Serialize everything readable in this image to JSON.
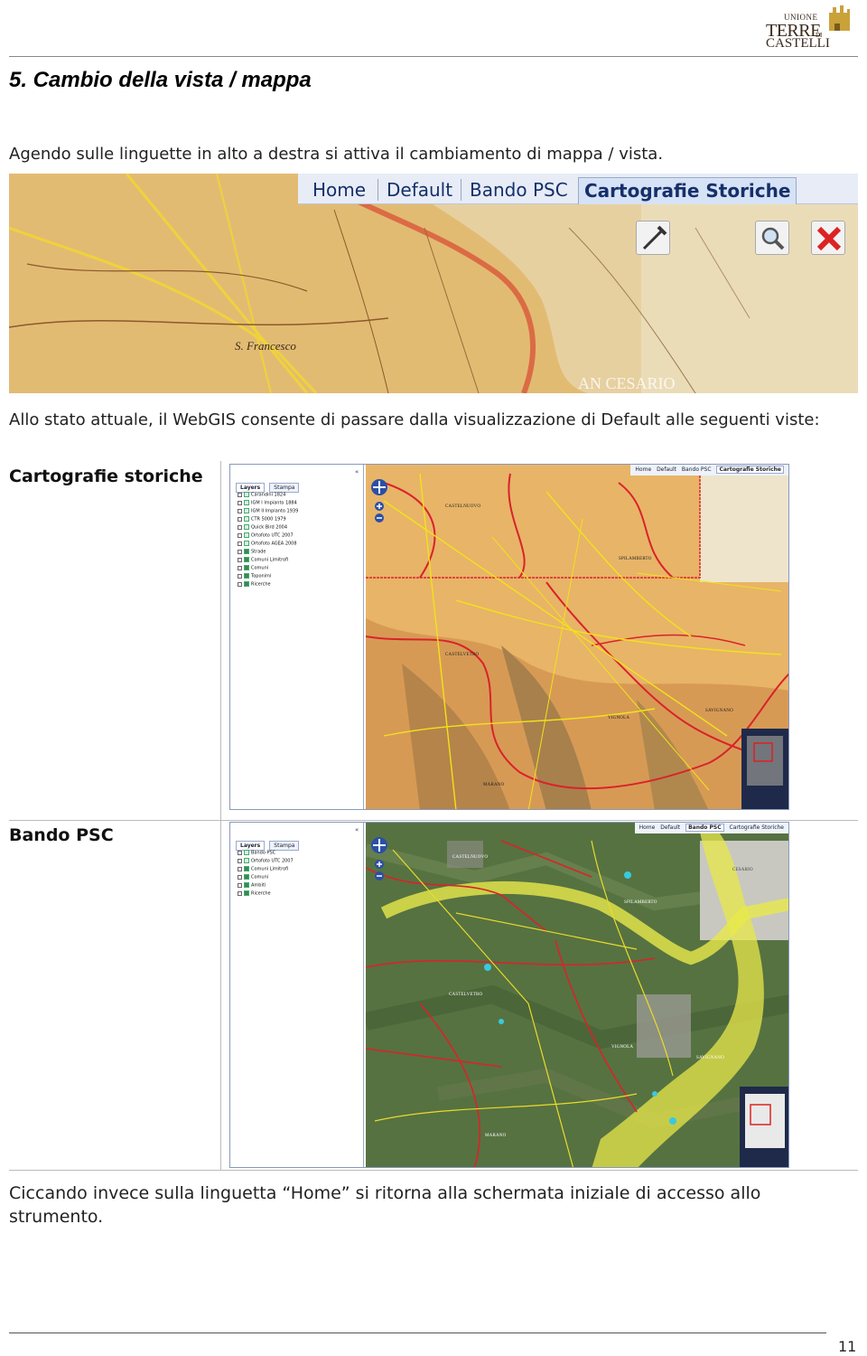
{
  "header": {
    "logo": {
      "small": "UNIONE",
      "mid": "TERRE",
      "di": "DI",
      "big": "CASTELLI"
    }
  },
  "title": "5. Cambio della vista / mappa",
  "para1": "Agendo sulle linguette in alto a destra si attiva il cambiamento di mappa / vista.",
  "shot1": {
    "tabs": [
      "Home",
      "Default",
      "Bando PSC",
      "Cartografie Storiche"
    ],
    "active_tab": "Cartografie Storiche",
    "map_labels": [
      "S. Francesco",
      "AN CESARIO"
    ]
  },
  "para2": "Allo stato attuale, il WebGIS consente di passare dalla visualizzazione di Default alle seguenti viste:",
  "views": [
    {
      "label": "Cartografie storiche",
      "panel_tabs": [
        "Layers",
        "Stampa"
      ],
      "map_tabs": [
        "Home",
        "Default",
        "Bando PSC",
        "Cartografie Storiche"
      ],
      "active_map_tab": "Cartografie Storiche",
      "layers": [
        {
          "name": "Carandini 1824",
          "checked": false
        },
        {
          "name": "IGM I Impianto 1884",
          "checked": false
        },
        {
          "name": "IGM II Impianto 1939",
          "checked": false
        },
        {
          "name": "CTR 5000 1979",
          "checked": false
        },
        {
          "name": "Quick Bird 2004",
          "checked": false
        },
        {
          "name": "Ortofoto UTC 2007",
          "checked": false
        },
        {
          "name": "Ortofoto AGEA 2008",
          "checked": false
        },
        {
          "name": "Strade",
          "checked": true
        },
        {
          "name": "Comuni Limitrofi",
          "checked": true
        },
        {
          "name": "Comuni",
          "checked": true
        },
        {
          "name": "Toponimi",
          "checked": true
        },
        {
          "name": "Ricerche",
          "checked": true
        }
      ],
      "places": [
        "CASTELNUOVO",
        "SPILAMBERTO",
        "CASTELVETRO",
        "VIGNOLA",
        "SAVIGNANO",
        "MARANO"
      ]
    },
    {
      "label": "Bando PSC",
      "panel_tabs": [
        "Layers",
        "Stampa"
      ],
      "map_tabs": [
        "Home",
        "Default",
        "Bando PSC",
        "Cartografie Storiche"
      ],
      "active_map_tab": "Bando PSC",
      "layers": [
        {
          "name": "Bando PSC",
          "checked": false
        },
        {
          "name": "Ortofoto UTC 2007",
          "checked": false
        },
        {
          "name": "Comuni Limitrofi",
          "checked": true
        },
        {
          "name": "Comuni",
          "checked": true
        },
        {
          "name": "Ambiti",
          "checked": true
        },
        {
          "name": "Ricerche",
          "checked": true
        }
      ],
      "places": [
        "CASTELNUOVO",
        "SPILAMBERTO",
        "CASTELVETRO",
        "VIGNOLA",
        "SAVIGNANO",
        "MARANO",
        "CESARIO"
      ]
    }
  ],
  "para3": "Ciccando invece sulla linguetta “Home” si ritorna alla schermata iniziale di accesso allo strumento.",
  "page_number": "11",
  "colors": {
    "tab_text": "#15306a",
    "old_map": "#e4b36a",
    "aerial": "#4f6a3c",
    "psc_area": "#e8e84a",
    "boundary": "#d2222a"
  }
}
